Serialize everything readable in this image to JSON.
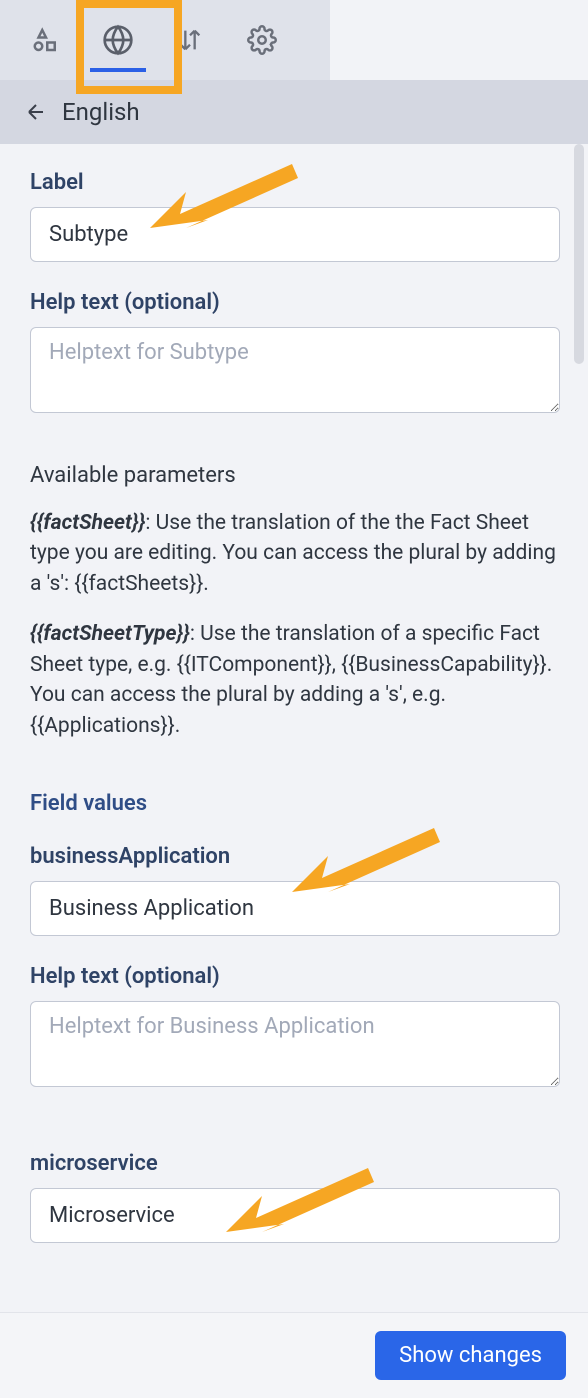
{
  "breadcrumb": {
    "language": "English"
  },
  "labels": {
    "label": "Label",
    "helptext": "Help text (optional)",
    "available_params": "Available parameters",
    "field_values": "Field values"
  },
  "fields": {
    "label_value": "Subtype",
    "helptext_placeholder": "Helptext for Subtype"
  },
  "params": {
    "p1_tag": "{{factSheet}}",
    "p1_rest": ": Use the translation of the the Fact Sheet type you are editing. You can access the plural by adding a 's': {{factSheets}}.",
    "p2_tag": "{{factSheetType}}",
    "p2_rest": ": Use the translation of a specific Fact Sheet type, e.g. {{ITComponent}}, {{BusinessCapability}}. You can access the plural by adding a 's', e.g. {{Applications}}."
  },
  "field_values": {
    "fv1_key": "businessApplication",
    "fv1_value": "Business Application",
    "fv1_help_placeholder": "Helptext for Business Application",
    "fv2_key": "microservice",
    "fv2_value": "Microservice"
  },
  "footer": {
    "show_changes": "Show changes"
  }
}
